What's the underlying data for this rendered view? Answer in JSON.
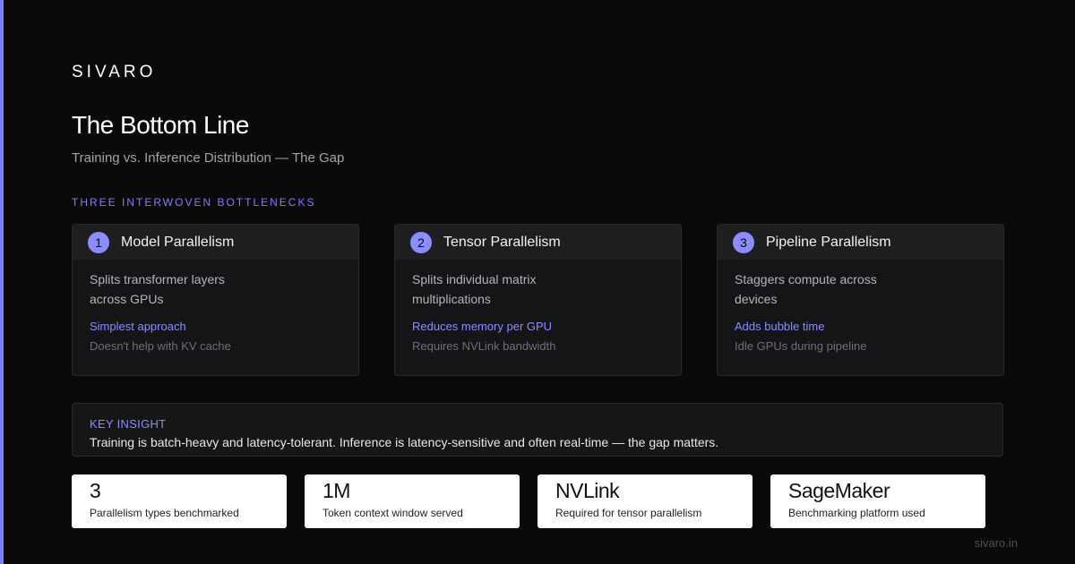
{
  "brand": "SIVARO",
  "title": "The Bottom Line",
  "subtitle": "Training vs. Inference Distribution — The Gap",
  "section_label": "THREE INTERWOVEN BOTTLENECKS",
  "accent_color": "#7b7fff",
  "cards": [
    {
      "number": "1",
      "title": "Model Parallelism",
      "description": "Splits transformer layers across GPUs",
      "highlight": "Simplest approach",
      "note": "Doesn't help with KV cache"
    },
    {
      "number": "2",
      "title": "Tensor Parallelism",
      "description": "Splits individual matrix multiplications",
      "highlight": "Reduces memory per GPU",
      "note": "Requires NVLink bandwidth"
    },
    {
      "number": "3",
      "title": "Pipeline Parallelism",
      "description": "Staggers compute across devices",
      "highlight": "Adds bubble time",
      "note": "Idle GPUs during pipeline"
    }
  ],
  "insight": {
    "label": "KEY INSIGHT",
    "text": "Training is batch-heavy and latency-tolerant. Inference is latency-sensitive and often real-time — the gap matters."
  },
  "stats": [
    {
      "value": "3",
      "label": "Parallelism types benchmarked"
    },
    {
      "value": "1M",
      "label": "Token context window served"
    },
    {
      "value": "NVLink",
      "label": "Required for tensor parallelism"
    },
    {
      "value": "SageMaker",
      "label": "Benchmarking platform used"
    }
  ],
  "footer_url": "sivaro.in"
}
